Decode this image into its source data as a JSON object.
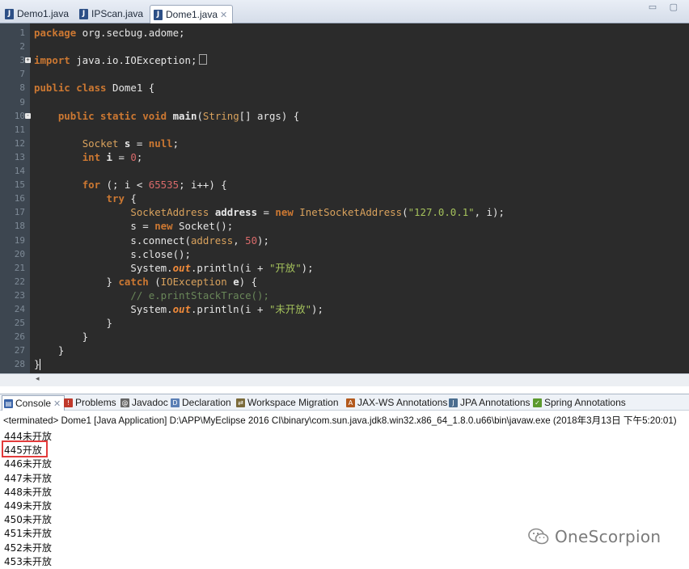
{
  "editor_tabs": [
    {
      "label": "Demo1.java",
      "active": false
    },
    {
      "label": "IPScan.java",
      "active": false
    },
    {
      "label": "Dome1.java",
      "active": true
    }
  ],
  "code_lines": [
    {
      "n": "1",
      "html": "<span class=\"kw\">package</span> org.secbug.adome;"
    },
    {
      "n": "2",
      "html": ""
    },
    {
      "n": "3",
      "fold": "+",
      "html": "<span class=\"kw\">import</span> java.io.IOException;<span class=\"box\"></span>"
    },
    {
      "n": "7",
      "html": ""
    },
    {
      "n": "8",
      "html": "<span class=\"kw\">public class</span> Dome1 {"
    },
    {
      "n": "9",
      "html": ""
    },
    {
      "n": "10",
      "fold": "-",
      "html": "    <span class=\"kw\">public static void</span> <b>main</b>(<span class=\"typ\">String</span>[] args) {"
    },
    {
      "n": "11",
      "html": ""
    },
    {
      "n": "12",
      "html": "        <span class=\"typ\">Socket</span> <span class=\"var\">s</span> = <span class=\"kw\">null</span>;"
    },
    {
      "n": "13",
      "html": "        <span class=\"kw\">int</span> <span class=\"var\">i</span> = <span class=\"num\">0</span>;"
    },
    {
      "n": "14",
      "html": ""
    },
    {
      "n": "15",
      "html": "        <span class=\"kw\">for</span> (; i &lt; <span class=\"num\">65535</span>; i++) {"
    },
    {
      "n": "16",
      "html": "            <span class=\"kw\">try</span> {"
    },
    {
      "n": "17",
      "html": "                <span class=\"typ\">SocketAddress</span> <span class=\"var\">address</span> = <span class=\"kw\">new</span> <span class=\"typ\">InetSocketAddress</span>(<span class=\"str\">\"127.0.0.1\"</span>, i);"
    },
    {
      "n": "18",
      "html": "                s = <span class=\"kw\">new</span> Socket();"
    },
    {
      "n": "19",
      "html": "                s.connect(<span class=\"typ\">address</span>, <span class=\"num\">50</span>);"
    },
    {
      "n": "20",
      "html": "                s.close();"
    },
    {
      "n": "21",
      "html": "                System.<span class=\"fld\">out</span>.println(i + <span class=\"str\">\"开放\"</span>);"
    },
    {
      "n": "22",
      "html": "            } <span class=\"kw\">catch</span> (<span class=\"typ\">IOException</span> <span class=\"var\">e</span>) {"
    },
    {
      "n": "23",
      "html": "                <span class=\"cmt\">// e.printStackTrace();</span>"
    },
    {
      "n": "24",
      "html": "                System.<span class=\"fld\">out</span>.println(i + <span class=\"str\">\"未开放\"</span>);"
    },
    {
      "n": "25",
      "html": "            }"
    },
    {
      "n": "26",
      "html": "        }"
    },
    {
      "n": "27",
      "html": "    }"
    },
    {
      "n": "28",
      "html": "}<span class=\"cur\"></span>"
    }
  ],
  "view_tabs": [
    {
      "label": "Console",
      "icon": "console-icon",
      "active": true,
      "color": "#3a64a8",
      "glyph": "▤"
    },
    {
      "label": "Problems",
      "icon": "problems-icon",
      "color": "#c0392b",
      "glyph": "!"
    },
    {
      "label": "Javadoc",
      "icon": "javadoc-icon",
      "color": "#666666",
      "glyph": "@"
    },
    {
      "label": "Declaration",
      "icon": "declaration-icon",
      "color": "#5a7fb5",
      "glyph": "D"
    },
    {
      "label": "Workspace Migration",
      "icon": "migration-icon",
      "color": "#7a6a3a",
      "glyph": "⇄"
    },
    {
      "label": "JAX-WS Annotations",
      "icon": "jaxws-icon",
      "color": "#b35a1e",
      "glyph": "A"
    },
    {
      "label": "JPA Annotations",
      "icon": "jpa-icon",
      "color": "#4a6d8f",
      "glyph": "J"
    },
    {
      "label": "Spring Annotations",
      "icon": "spring-icon",
      "color": "#5c9a2e",
      "glyph": "✓"
    }
  ],
  "status_line": "<terminated> Dome1 [Java Application] D:\\APP\\MyEclipse 2016 CI\\binary\\com.sun.java.jdk8.win32.x86_64_1.8.0.u66\\bin\\javaw.exe (2018年3月13日 下午5:20:01)",
  "console_lines": [
    "444未开放",
    "445开放",
    "446未开放",
    "447未开放",
    "448未开放",
    "449未开放",
    "450未开放",
    "451未开放",
    "452未开放",
    "453未开放"
  ],
  "highlight_line": "445开放",
  "watermark": {
    "text": "OneScorpion",
    "icon": "wechat-icon"
  }
}
